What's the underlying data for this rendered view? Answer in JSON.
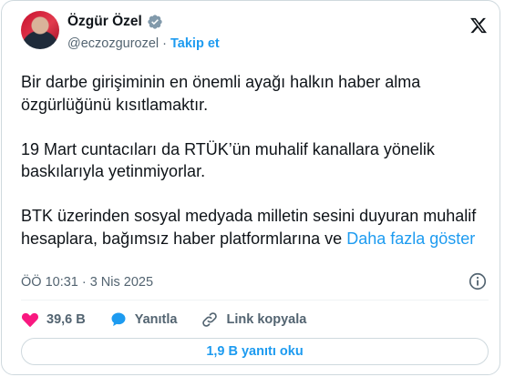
{
  "author": {
    "name": "Özgür Özel",
    "handle": "@eczozgurozel",
    "separator": "·",
    "follow_label": "Takip et"
  },
  "tweet": {
    "paragraphs": [
      "Bir darbe girişiminin en önemli ayağı halkın haber alma özgürlüğünü kısıtlamaktır.",
      "19 Mart cuntacıları da RTÜK’ün muhalif kanallara yönelik baskılarıyla yetinmiyorlar."
    ],
    "last_paragraph": "BTK üzerinden sosyal medyada milletin sesini duyuran muhalif hesaplara, bağımsız haber platformlarına ve",
    "show_more_label": "Daha fazla göster"
  },
  "meta": {
    "time": "ÖÖ 10:31",
    "separator": "·",
    "date": "3 Nis 2025"
  },
  "actions": {
    "likes": "39,6 B",
    "reply_label": "Yanıtla",
    "copy_link_label": "Link kopyala"
  },
  "read_replies_label": "1,9 B yanıtı oku",
  "colors": {
    "accent": "#1d9bf0",
    "like": "#f91880",
    "text": "#0f1419",
    "secondary": "#536471"
  }
}
